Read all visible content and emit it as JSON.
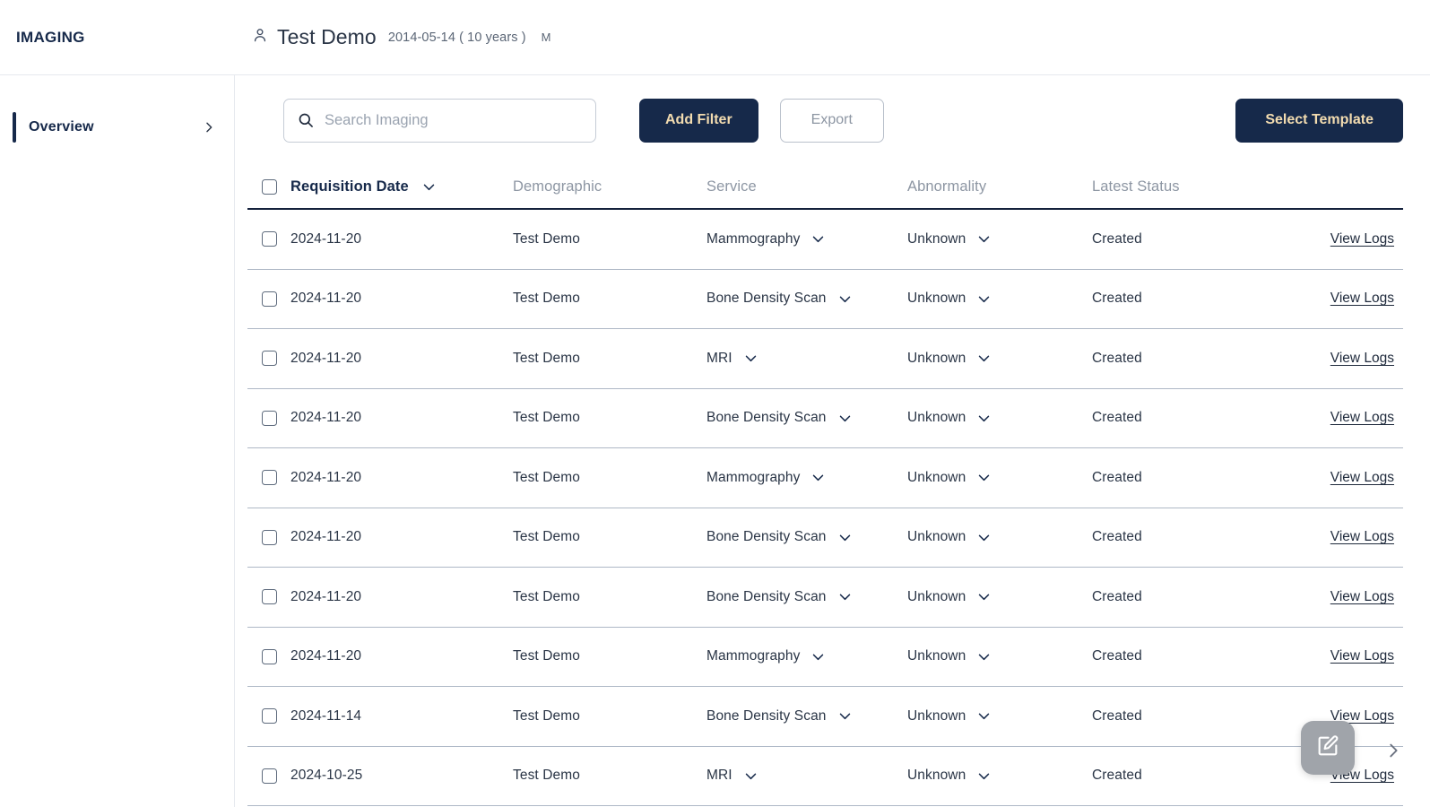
{
  "header": {
    "brand": "IMAGING",
    "person_icon": "person-icon",
    "patient_name": "Test Demo",
    "patient_dob": "2014-05-14 ( 10 years )",
    "patient_sex": "M"
  },
  "sidebar": {
    "items": [
      {
        "label": "Overview",
        "chevron_icon": "chevron-right-icon",
        "active": true
      }
    ]
  },
  "toolbar": {
    "search_placeholder": "Search Imaging",
    "search_value": "",
    "search_icon": "search-icon",
    "add_filter_label": "Add Filter",
    "export_label": "Export",
    "select_template_label": "Select Template"
  },
  "colors": {
    "navy": "#16294a",
    "gold": "#f3dcb0",
    "muted": "#8d96a3",
    "row_border": "#aeb8c6",
    "fab_gray": "#a0a4aa"
  },
  "table": {
    "columns": [
      {
        "key": "date",
        "label": "Requisition Date",
        "active": true,
        "sort_icon": "chevron-down-icon"
      },
      {
        "key": "demo",
        "label": "Demographic",
        "active": false
      },
      {
        "key": "service",
        "label": "Service",
        "active": false
      },
      {
        "key": "abn",
        "label": "Abnormality",
        "active": false
      },
      {
        "key": "status",
        "label": "Latest Status",
        "active": false
      }
    ],
    "logs_label": "View Logs",
    "rows": [
      {
        "date": "2024-11-20",
        "demographic": "Test Demo",
        "service": "Mammography",
        "abnormality": "Unknown",
        "status": "Created",
        "logs": "View Logs"
      },
      {
        "date": "2024-11-20",
        "demographic": "Test Demo",
        "service": "Bone Density Scan",
        "abnormality": "Unknown",
        "status": "Created",
        "logs": "View Logs"
      },
      {
        "date": "2024-11-20",
        "demographic": "Test Demo",
        "service": "MRI",
        "abnormality": "Unknown",
        "status": "Created",
        "logs": "View Logs"
      },
      {
        "date": "2024-11-20",
        "demographic": "Test Demo",
        "service": "Bone Density Scan",
        "abnormality": "Unknown",
        "status": "Created",
        "logs": "View Logs"
      },
      {
        "date": "2024-11-20",
        "demographic": "Test Demo",
        "service": "Mammography",
        "abnormality": "Unknown",
        "status": "Created",
        "logs": "View Logs"
      },
      {
        "date": "2024-11-20",
        "demographic": "Test Demo",
        "service": "Bone Density Scan",
        "abnormality": "Unknown",
        "status": "Created",
        "logs": "View Logs"
      },
      {
        "date": "2024-11-20",
        "demographic": "Test Demo",
        "service": "Bone Density Scan",
        "abnormality": "Unknown",
        "status": "Created",
        "logs": "View Logs"
      },
      {
        "date": "2024-11-20",
        "demographic": "Test Demo",
        "service": "Mammography",
        "abnormality": "Unknown",
        "status": "Created",
        "logs": "View Logs"
      },
      {
        "date": "2024-11-14",
        "demographic": "Test Demo",
        "service": "Bone Density Scan",
        "abnormality": "Unknown",
        "status": "Created",
        "logs": "View Logs"
      },
      {
        "date": "2024-10-25",
        "demographic": "Test Demo",
        "service": "MRI",
        "abnormality": "Unknown",
        "status": "Created",
        "logs": "View Logs"
      }
    ]
  },
  "floating": {
    "edit_icon": "edit-square-icon",
    "next_icon": "chevron-right-icon"
  }
}
